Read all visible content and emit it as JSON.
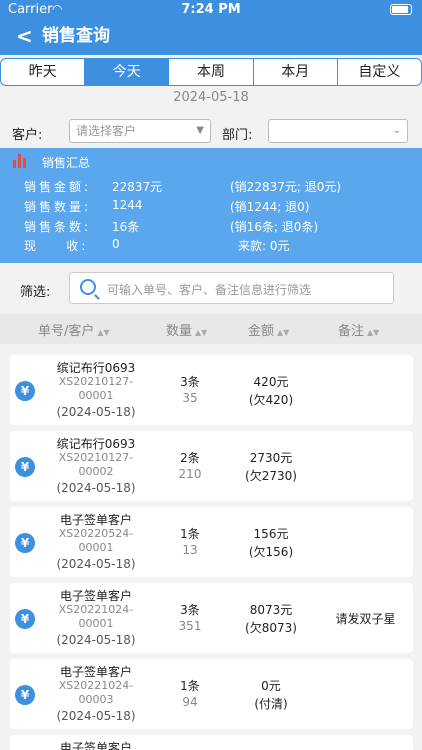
{
  "status": {
    "carrier": "Carrier",
    "time": "7:24 PM"
  },
  "nav": {
    "title": "销售查询"
  },
  "tabs": [
    "昨天",
    "今天",
    "本周",
    "本月",
    "自定义"
  ],
  "date": "2024-05-18",
  "filters": {
    "customer_label": "客户:",
    "customer_placeholder": "请选择客户",
    "dept_label": "部门:"
  },
  "summary": {
    "title": "销售汇总",
    "rows": [
      {
        "label": "销售金额:",
        "value": "22837元",
        "right": "(销22837元; 退0元)"
      },
      {
        "label": "销售数量:",
        "value": "1244",
        "right": "(销1244; 退0)"
      },
      {
        "label": "销售条数:",
        "value": "16条",
        "right": "(销16条; 退0条)"
      },
      {
        "label": "现    收:",
        "value": "0",
        "right": "来款: 0元"
      }
    ]
  },
  "search": {
    "label": "筛选:",
    "placeholder": "可输入单号、客户、备注信息进行筛选"
  },
  "table_head": {
    "order": "单号/客户",
    "qty": "数量",
    "amount": "金额",
    "note": "备注"
  },
  "rows": [
    {
      "name": "缤记布行0693",
      "no1": "XS20210127-",
      "no2": "00001",
      "date": "(2024-05-18)",
      "qty": "3条",
      "qty2": "35",
      "amt": "420元",
      "amt2": "(欠420)",
      "note": ""
    },
    {
      "name": "缤记布行0693",
      "no1": "XS20210127-",
      "no2": "00002",
      "date": "(2024-05-18)",
      "qty": "2条",
      "qty2": "210",
      "amt": "2730元",
      "amt2": "(欠2730)",
      "note": ""
    },
    {
      "name": "电子签单客户",
      "no1": "XS20220524-",
      "no2": "00001",
      "date": "(2024-05-18)",
      "qty": "1条",
      "qty2": "13",
      "amt": "156元",
      "amt2": "(欠156)",
      "note": ""
    },
    {
      "name": "电子签单客户",
      "no1": "XS20221024-",
      "no2": "00001",
      "date": "(2024-05-18)",
      "qty": "3条",
      "qty2": "351",
      "amt": "8073元",
      "amt2": "(欠8073)",
      "note": "请发双子星"
    },
    {
      "name": "电子签单客户",
      "no1": "XS20221024-",
      "no2": "00003",
      "date": "(2024-05-18)",
      "qty": "1条",
      "qty2": "94",
      "amt": "0元",
      "amt2": "(付清)",
      "note": ""
    },
    {
      "name": "电子签单客户",
      "no1": "",
      "no2": "",
      "date": "",
      "qty": "",
      "qty2": "",
      "amt": "",
      "amt2": "",
      "note": ""
    }
  ]
}
